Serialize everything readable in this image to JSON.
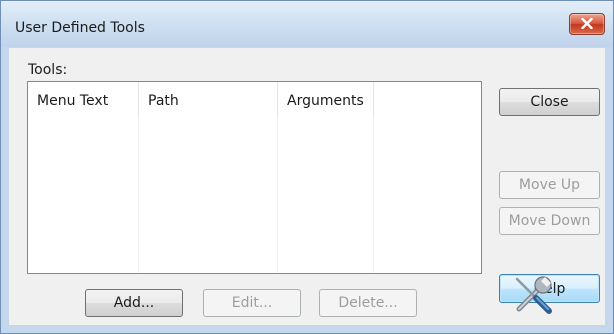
{
  "window": {
    "title": "User Defined Tools"
  },
  "tools": {
    "label": "Tools:",
    "columns": [
      "Menu Text",
      "Path",
      "Arguments",
      ""
    ],
    "rows": []
  },
  "buttons": {
    "close": "Close",
    "move_up": "Move Up",
    "move_down": "Move Down",
    "help": "Help",
    "add": "Add...",
    "edit": "Edit...",
    "delete": "Delete..."
  },
  "icons": {
    "title_close": "close-icon",
    "tools": "tools-icon"
  }
}
